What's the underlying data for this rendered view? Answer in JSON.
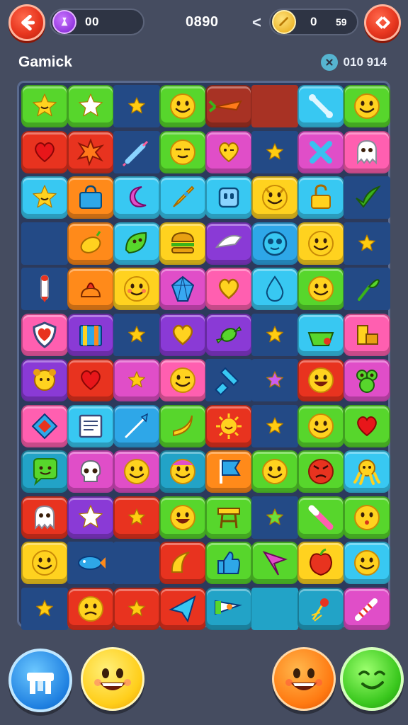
{
  "header": {
    "back_icon": "back-arrow-icon",
    "left_counter": {
      "icon": "potion-icon",
      "value": "00"
    },
    "score": "0890",
    "chevron": "<",
    "right_counter": {
      "icon": "coin-icon",
      "value": "0",
      "sub": "59"
    },
    "skip_icon": "skip-icon"
  },
  "subheader": {
    "title": "Gamick",
    "moves_icon": "close-icon",
    "moves": "010  914"
  },
  "colors": {
    "green": "#57d62c",
    "blue": "#2ea7e8",
    "navy": "#234a86",
    "yellow": "#ffd21f",
    "maroon": "#a83224",
    "cyan": "#38c8f2",
    "red": "#e8331f",
    "orange": "#ff8a1a",
    "magenta": "#e04ec8",
    "pink": "#ff5fb0",
    "purple": "#8a3ad6",
    "teal": "#22a3c7"
  },
  "board": {
    "rows": [
      [
        "green:smile-star-icon",
        "green:star-icon",
        "navy:small-star-icon",
        "green:smiley-icon",
        "maroon:carrot-icon",
        "maroon:empty",
        "cyan:bone-icon",
        "green:smiley-icon"
      ],
      [
        "red:heart-icon",
        "red:splat-icon",
        "navy:syringe-icon",
        "green:sleepy-face-icon",
        "magenta:wink-heart-icon",
        "navy:small-star-icon",
        "magenta:cross-icon",
        "pink:ghost-icon"
      ],
      [
        "cyan:smile-star-icon",
        "orange:bag-icon",
        "cyan:moon-icon",
        "cyan:rocket-icon",
        "cyan:robot-icon",
        "yellow:devil-face-icon",
        "cyan:lock-icon",
        "navy:leaf-icon"
      ],
      [
        "navy:empty",
        "orange:lemon-icon",
        "cyan:leaf-face-icon",
        "yellow:burger-icon",
        "purple:slice-icon",
        "blue:alien-icon",
        "yellow:smiley-icon",
        "navy:small-star-icon"
      ],
      [
        "navy:pencil-icon",
        "orange:cake-icon",
        "yellow:blush-face-icon",
        "magenta:crystal-icon",
        "pink:heart-outline-icon",
        "cyan:drop-icon",
        "green:smiley-icon",
        "navy:sprout-icon"
      ],
      [
        "pink:shield-icon",
        "purple:book-icon",
        "navy:small-star-icon",
        "purple:heart-outline-icon",
        "purple:candy-icon",
        "navy:small-star-icon",
        "cyan:basket-icon",
        "pink:chair-icon"
      ],
      [
        "purple:puppy-icon",
        "red:heart-icon",
        "magenta:small-star-icon",
        "pink:wink-face-icon",
        "navy:bottle-icon",
        "navy:purple-star-icon",
        "red:laugh-face-icon",
        "magenta:frog-icon"
      ],
      [
        "pink:gem-box-icon",
        "cyan:photo-icon",
        "blue:brush-icon",
        "green:banana-icon",
        "red:sun-face-icon",
        "navy:small-star-icon",
        "green:smiley-icon",
        "green:heart-icon"
      ],
      [
        "teal:speech-face-icon",
        "magenta:skull-icon",
        "magenta:smiley-icon",
        "teal:cap-face-icon",
        "orange:flag-icon",
        "green:smiley-icon",
        "green:angry-face-icon",
        "cyan:octopus-icon"
      ],
      [
        "red:ghost-icon",
        "purple:star-icon",
        "red:small-star-icon",
        "green:laugh-face-icon",
        "green:stool-icon",
        "navy:green-star-icon",
        "green:wand-icon",
        "green:kiss-face-icon"
      ],
      [
        "yellow:smiley-icon",
        "navy:fish-icon",
        "navy:empty",
        "red:croissant-icon",
        "green:thumb-icon",
        "green:leaf-bird-icon",
        "yellow:apple-icon",
        "cyan:smiley-icon"
      ],
      [
        "navy:small-star-icon",
        "red:sad-face-icon",
        "red:small-star-icon",
        "red:paper-plane-icon",
        "teal:pencil-flag-icon",
        "teal:empty",
        "teal:flower-icon",
        "magenta:candy-cane-icon"
      ]
    ]
  },
  "footer": {
    "buttons": [
      "shop-icon",
      "happy-face-icon",
      "laughing-face-icon",
      "smirk-face-icon"
    ]
  }
}
